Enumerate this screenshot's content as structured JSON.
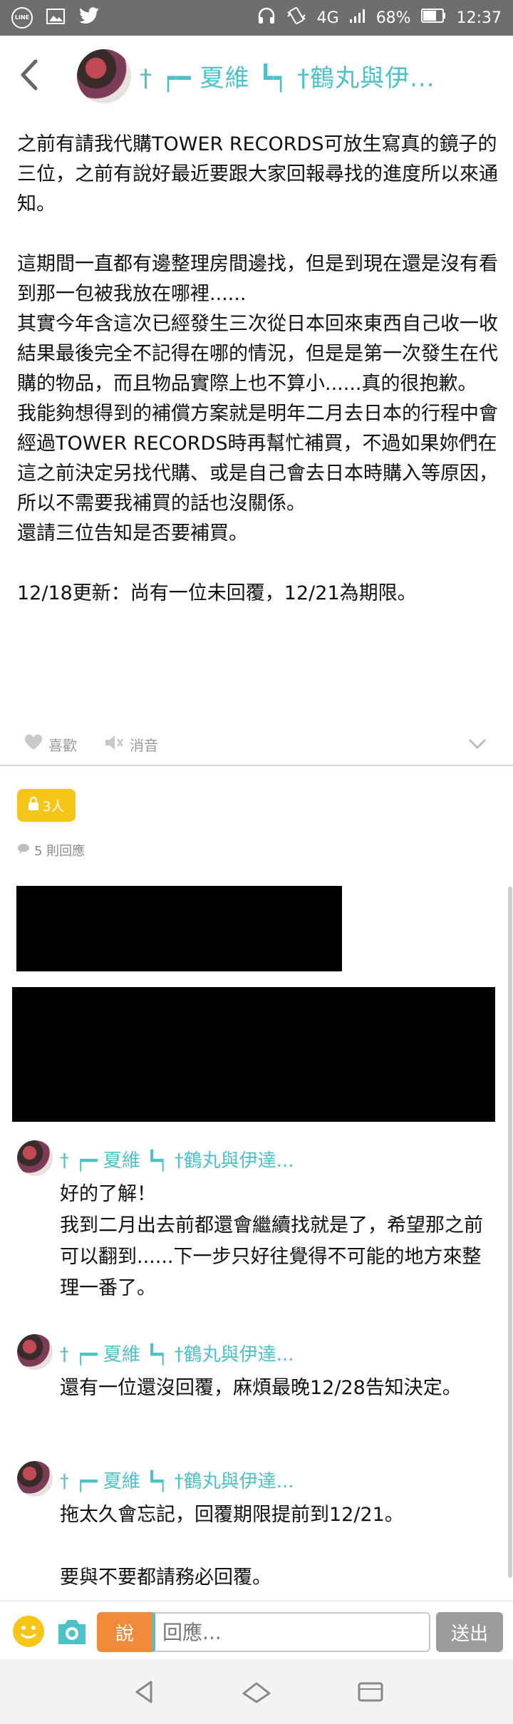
{
  "status_bar": {
    "network": "4G",
    "battery": "68%",
    "time": "12:37",
    "icons": [
      "line-icon",
      "image-icon",
      "twitter-icon",
      "headphones-icon",
      "vibrate-icon",
      "signal-icon",
      "battery-icon"
    ]
  },
  "header": {
    "title": "† ┍━ 夏維 ┗┑ †鶴丸與伊..."
  },
  "post": {
    "paragraph1": "之前有請我代購TOWER RECORDS可放生寫真的鏡子的三位，之前有說好最近要跟大家回報尋找的進度所以來通知。",
    "paragraph2": "這期間一直都有邊整理房間邊找，但是到現在還是沒有看到那一包被我放在哪裡......\n其實今年含這次已經發生三次從日本回來東西自己收一收結果最後完全不記得在哪的情況，但是是第一次發生在代購的物品，而且物品實際上也不算小......真的很抱歉。\n我能夠想得到的補償方案就是明年二月去日本的行程中會經過TOWER RECORDS時再幫忙補買，不過如果妳們在這之前決定另找代購、或是自己會去日本時購入等原因，所以不需要我補買的話也沒關係。\n還請三位告知是否要補買。",
    "update": "12/18更新：尚有一位未回覆，12/21為期限。"
  },
  "actions": {
    "like_label": "喜歡",
    "mute_label": "消音"
  },
  "lock_badge": "3人",
  "reply_count": "5 則回應",
  "comments": [
    {
      "name": "† ┍━ 夏維 ┗┑ †鶴丸與伊達...",
      "text": "好的了解！\n我到二月出去前都還會繼續找就是了，希望那之前可以翻到......下一步只好往覺得不可能的地方來整理一番了。"
    },
    {
      "name": "† ┍━ 夏維 ┗┑ †鶴丸與伊達...",
      "text": "還有一位還沒回覆，麻煩最晚12/28告知決定。"
    },
    {
      "name": "† ┍━ 夏維 ┗┑ †鶴丸與伊達...",
      "text": "拖太久會忘記，回覆期限提前到12/21。\n\n要與不要都請務必回覆。"
    }
  ],
  "input_bar": {
    "say_label": "說",
    "placeholder": "回應...",
    "send_label": "送出"
  },
  "colors": {
    "accent": "#4cc1c8",
    "badge": "#f5c518",
    "say": "#ef8b3a"
  }
}
